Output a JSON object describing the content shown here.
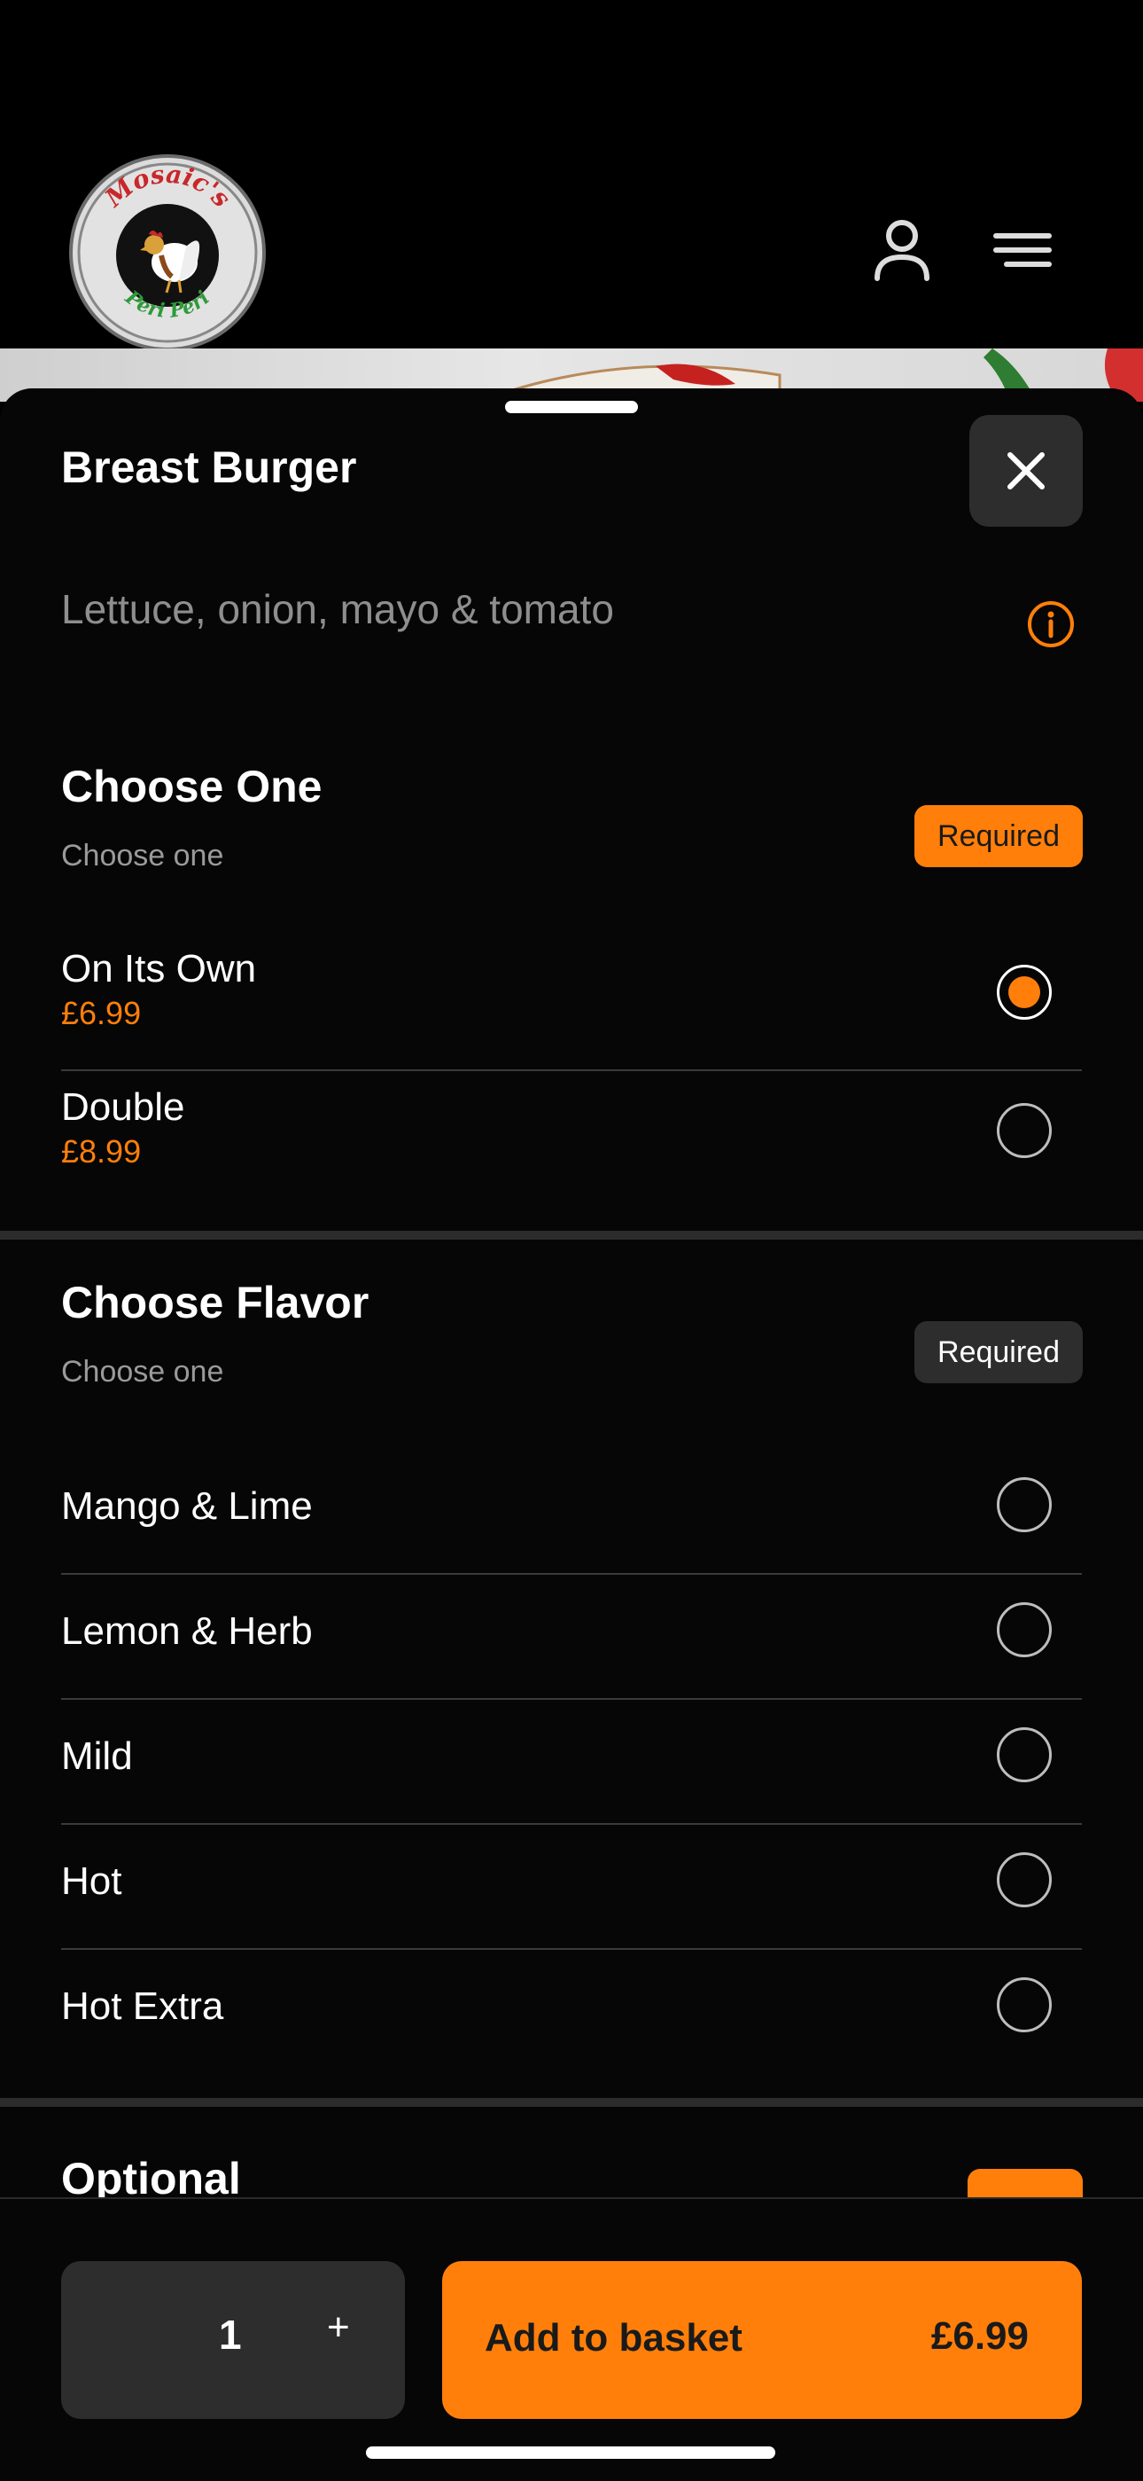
{
  "header": {
    "logo_top_text": "Mosaic's",
    "logo_bottom_text": "Peri Peri",
    "user_icon": "user-icon",
    "menu_icon": "menu-icon"
  },
  "item": {
    "title": "Breast Burger",
    "description": "Lettuce, onion, mayo & tomato",
    "close_icon": "close-icon",
    "info_icon": "info-icon"
  },
  "groups": [
    {
      "title": "Choose One",
      "subtitle": "Choose one",
      "badge": "Required",
      "badge_color": "#ff7f0a",
      "options": [
        {
          "name": "On Its Own",
          "price": "£6.99",
          "selected": true
        },
        {
          "name": "Double",
          "price": "£8.99",
          "selected": false
        }
      ]
    },
    {
      "title": "Choose Flavor",
      "subtitle": "Choose one",
      "badge": "Required",
      "badge_color": "#2d2d2d",
      "options": [
        {
          "name": "Mango & Lime",
          "selected": false
        },
        {
          "name": "Lemon & Herb",
          "selected": false
        },
        {
          "name": "Mild",
          "selected": false
        },
        {
          "name": "Hot",
          "selected": false
        },
        {
          "name": "Hot Extra",
          "selected": false
        }
      ]
    },
    {
      "title": "Optional"
    }
  ],
  "footer": {
    "quantity": "1",
    "plus_label": "+",
    "add_label": "Add to basket",
    "add_price": "£6.99"
  },
  "colors": {
    "accent": "#ff7f0a",
    "background": "#060606",
    "surface": "#2d2d2d"
  }
}
